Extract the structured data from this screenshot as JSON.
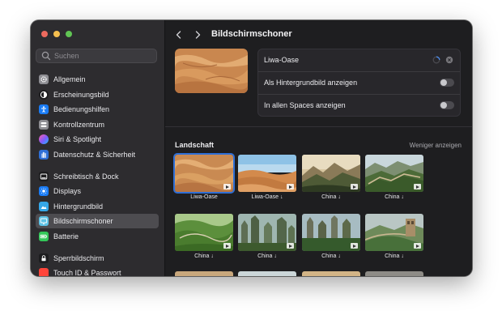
{
  "window": {
    "traffic_lights": [
      "close",
      "minimize",
      "zoom"
    ]
  },
  "sidebar": {
    "search_placeholder": "Suchen",
    "items": [
      {
        "label": "Allgemein",
        "icon": "gear-icon",
        "color": "#8e8e93"
      },
      {
        "label": "Erscheinungsbild",
        "icon": "appearance-icon",
        "color": "#1c1c1e"
      },
      {
        "label": "Bedienungshilfen",
        "icon": "accessibility-icon",
        "color": "#1a7cf5"
      },
      {
        "label": "Kontrollzentrum",
        "icon": "control-center-icon",
        "color": "#8e8e93"
      },
      {
        "label": "Siri & Spotlight",
        "icon": "siri-icon",
        "color": "#c04be0"
      },
      {
        "label": "Datenschutz & Sicherheit",
        "icon": "privacy-hand-icon",
        "color": "#2f6fd6"
      },
      {
        "label": "Schreibtisch & Dock",
        "icon": "dock-icon",
        "color": "#1c1c1e"
      },
      {
        "label": "Displays",
        "icon": "display-brightness-icon",
        "color": "#1a7cf5"
      },
      {
        "label": "Hintergrundbild",
        "icon": "wallpaper-icon",
        "color": "#35a7e8"
      },
      {
        "label": "Bildschirmschoner",
        "icon": "screensaver-icon",
        "color": "#5ec3e6"
      },
      {
        "label": "Batterie",
        "icon": "battery-icon",
        "color": "#33c759"
      },
      {
        "label": "Sperrbildschirm",
        "icon": "lock-icon",
        "color": "#1c1c1e"
      },
      {
        "label": "Touch ID & Passwort",
        "icon": "fingerprint-icon",
        "color": "#ff453a"
      }
    ],
    "selected_index": 9
  },
  "header": {
    "title": "Bildschirmschoner",
    "back_icon": "chevron-left-icon",
    "forward_icon": "chevron-right-icon"
  },
  "current": {
    "name": "Liwa-Oase",
    "show_as_wallpaper_label": "Als Hintergrundbild anzeigen",
    "show_as_wallpaper": false,
    "all_spaces_label": "In allen Spaces anzeigen",
    "all_spaces": false
  },
  "section": {
    "title": "Landschaft",
    "toggle_link": "Weniger anzeigen"
  },
  "savers": [
    {
      "caption": "Liwa-Oase",
      "scene": "dunes",
      "selected": true
    },
    {
      "caption": "Liwa-Oase ↓",
      "scene": "dunes-sky",
      "selected": false
    },
    {
      "caption": "China ↓",
      "scene": "misty-mountains",
      "selected": false
    },
    {
      "caption": "China ↓",
      "scene": "great-wall",
      "selected": false
    },
    {
      "caption": "China ↓",
      "scene": "green-hills",
      "selected": false
    },
    {
      "caption": "China ↓",
      "scene": "karst-peaks",
      "selected": false
    },
    {
      "caption": "China ↓",
      "scene": "karst-forest",
      "selected": false
    },
    {
      "caption": "China ↓",
      "scene": "great-wall-tower",
      "selected": false
    }
  ],
  "colors": {
    "accent": "#2f6fd6",
    "window_bg": "#1e1e20",
    "sidebar_bg": "#2d2c2f"
  }
}
